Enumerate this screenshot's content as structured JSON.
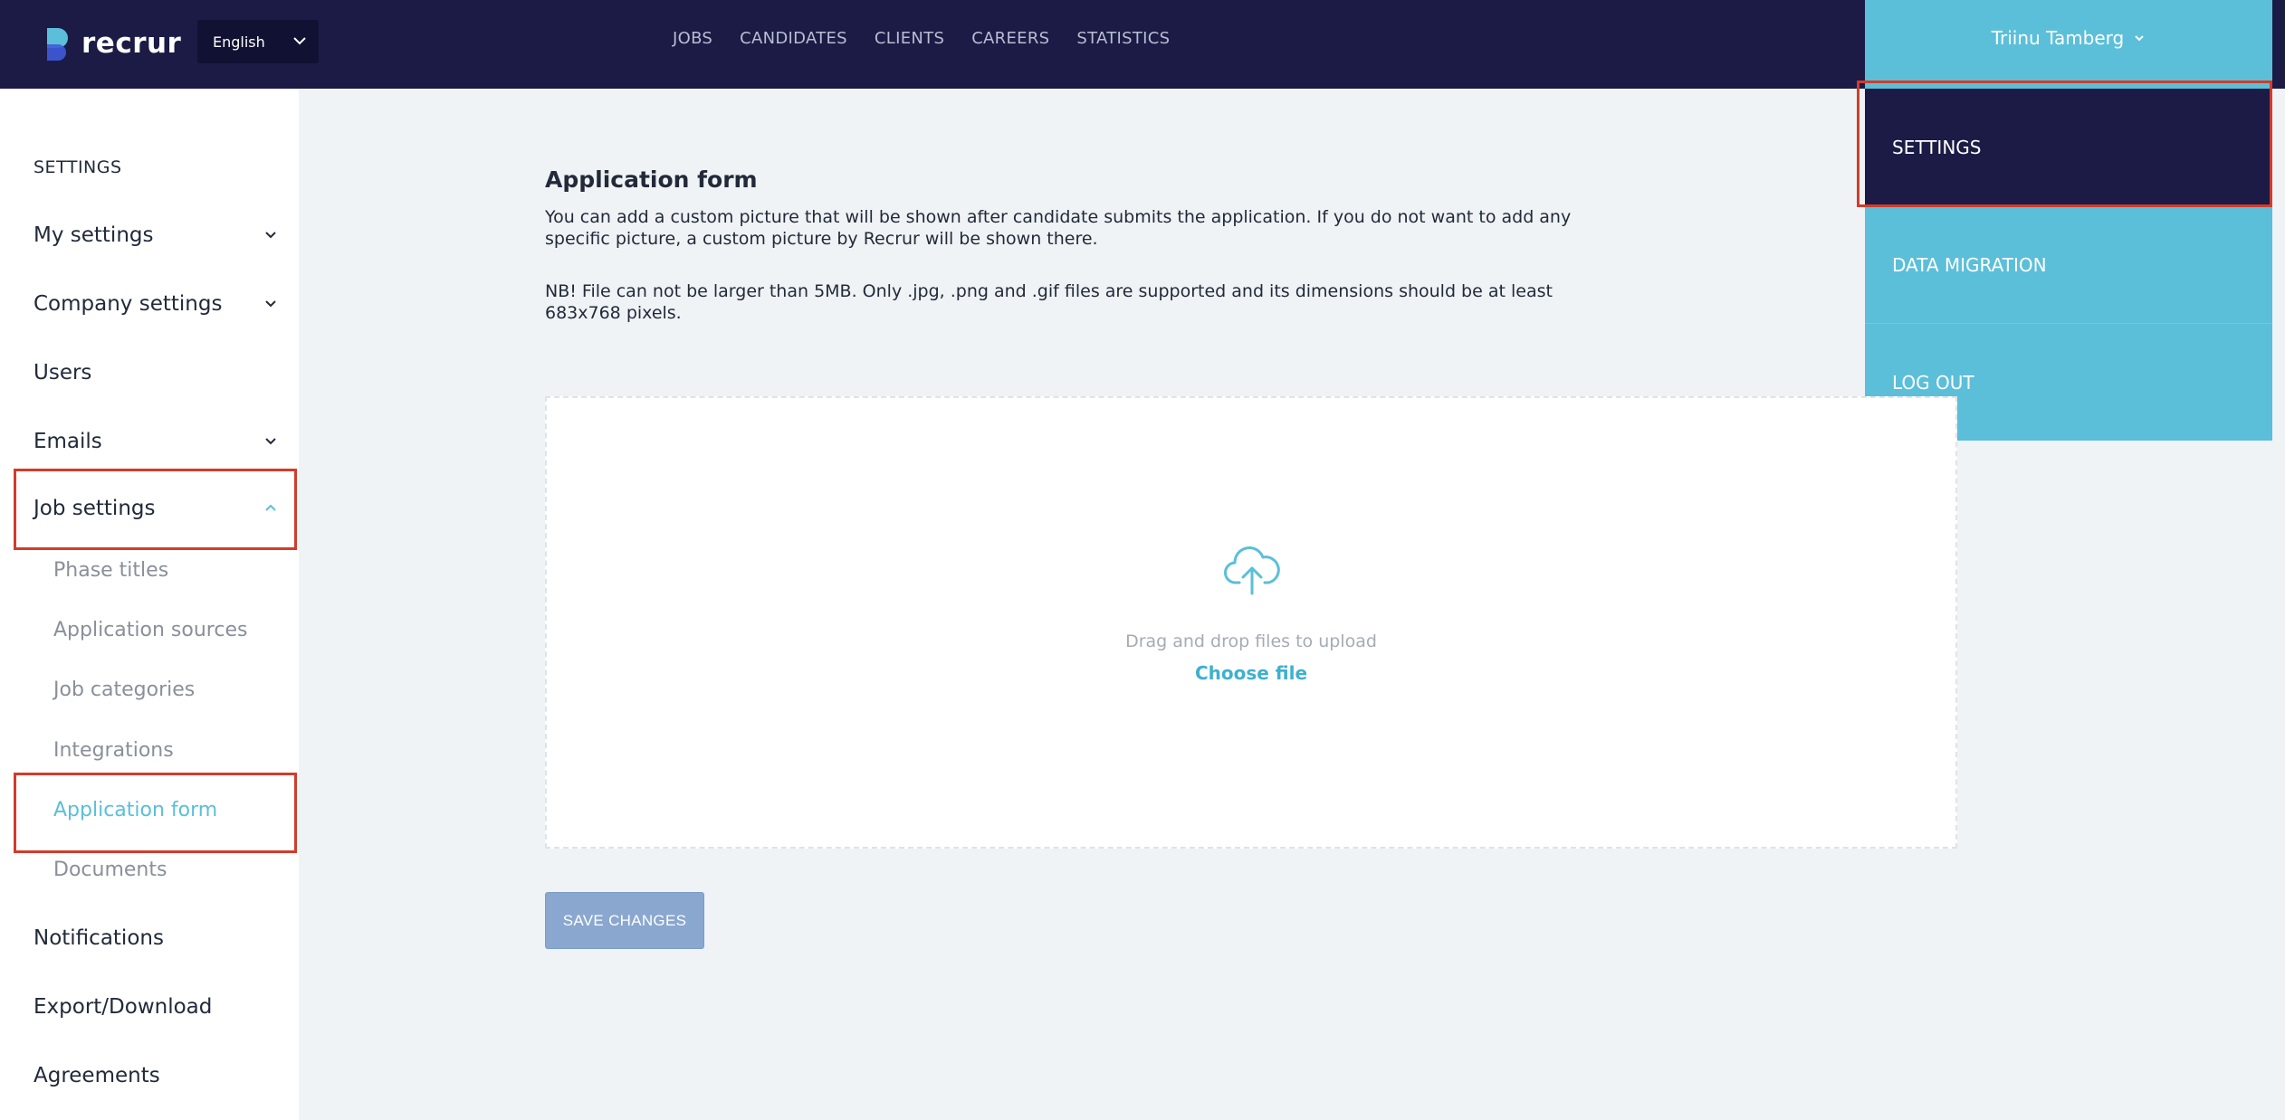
{
  "header": {
    "logo_text": "recrur",
    "language": "English",
    "nav": [
      "JOBS",
      "CANDIDATES",
      "CLIENTS",
      "CAREERS",
      "STATISTICS"
    ],
    "user_name": "Triinu Tamberg"
  },
  "user_menu": {
    "items": [
      "SETTINGS",
      "DATA MIGRATION",
      "LOG OUT"
    ]
  },
  "sidebar": {
    "heading": "SETTINGS",
    "items": {
      "my_settings": "My settings",
      "company_settings": "Company settings",
      "users": "Users",
      "emails": "Emails",
      "job_settings": "Job settings",
      "notifications": "Notifications",
      "export": "Export/Download",
      "agreements": "Agreements"
    },
    "job_sub": [
      "Phase titles",
      "Application sources",
      "Job categories",
      "Integrations",
      "Application form",
      "Documents"
    ]
  },
  "main": {
    "title": "Application form",
    "description": "You can add a custom picture that will be shown after candidate submits the application. If you do not want to add any specific picture, a custom picture by Recrur will be shown there.",
    "note": "NB! File can not be larger than 5MB. Only .jpg, .png and .gif files are supported and its dimensions should be at least 683x768 pixels.",
    "dropzone_text": "Drag and drop files to upload",
    "choose_file": "Choose file",
    "save_label": "SAVE CHANGES"
  },
  "colors": {
    "navy": "#1b1b45",
    "accent": "#5bbfd9",
    "highlight": "#d23c2a",
    "save_button": "#89a7cf"
  }
}
